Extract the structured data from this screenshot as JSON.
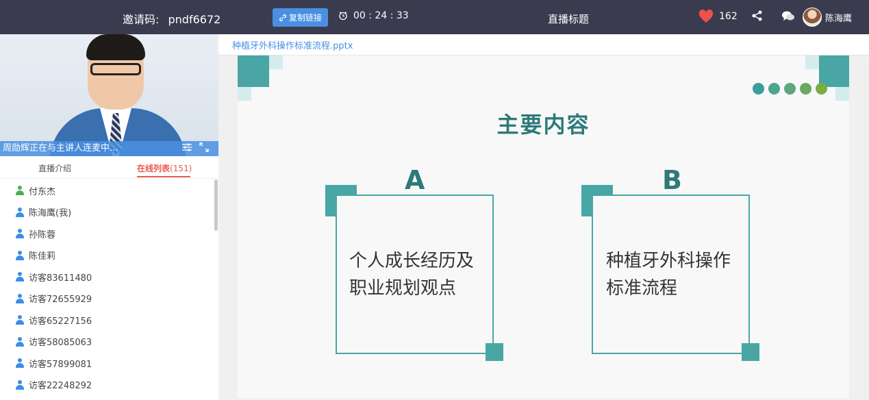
{
  "header": {
    "invite_label": "邀请码:",
    "invite_code": "pndf6672",
    "copy_link_label": "复制链接",
    "timer": "00 : 24 : 33",
    "live_title": "直播标题",
    "like_count": "162",
    "user_name": "陈海鹰"
  },
  "video": {
    "caption": "周勋辉正在与主讲人连麦中..."
  },
  "tabs": {
    "intro": "直播介绍",
    "online_list": "在线列表",
    "online_count": "(151)"
  },
  "online_users": [
    {
      "name": "付东杰",
      "color": "#4caf50"
    },
    {
      "name": "陈海鹰(我)",
      "color": "#3a8ee6"
    },
    {
      "name": "孙陈蓉",
      "color": "#3a8ee6"
    },
    {
      "name": "陈佳莉",
      "color": "#3a8ee6"
    },
    {
      "name": "访客83611480",
      "color": "#3a8ee6"
    },
    {
      "name": "访客72655929",
      "color": "#3a8ee6"
    },
    {
      "name": "访客65227156",
      "color": "#3a8ee6"
    },
    {
      "name": "访客58085063",
      "color": "#3a8ee6"
    },
    {
      "name": "访客57899081",
      "color": "#3a8ee6"
    },
    {
      "name": "访客22248292",
      "color": "#3a8ee6"
    }
  ],
  "slide": {
    "filename": "种植牙外科操作标准流程.pptx",
    "title": "主要内容",
    "card_a_letter": "A",
    "card_a_line1": "个人成长经历及",
    "card_a_line2": "职业规划观点",
    "card_b_letter": "B",
    "card_b_line1": "种植牙外科操作",
    "card_b_line2": "标准流程"
  },
  "colors": {
    "topbar": "#3a3b4f",
    "accent_blue": "#4a90e2",
    "active_tab": "#e85a4f",
    "teal": "#4aa5a5"
  }
}
